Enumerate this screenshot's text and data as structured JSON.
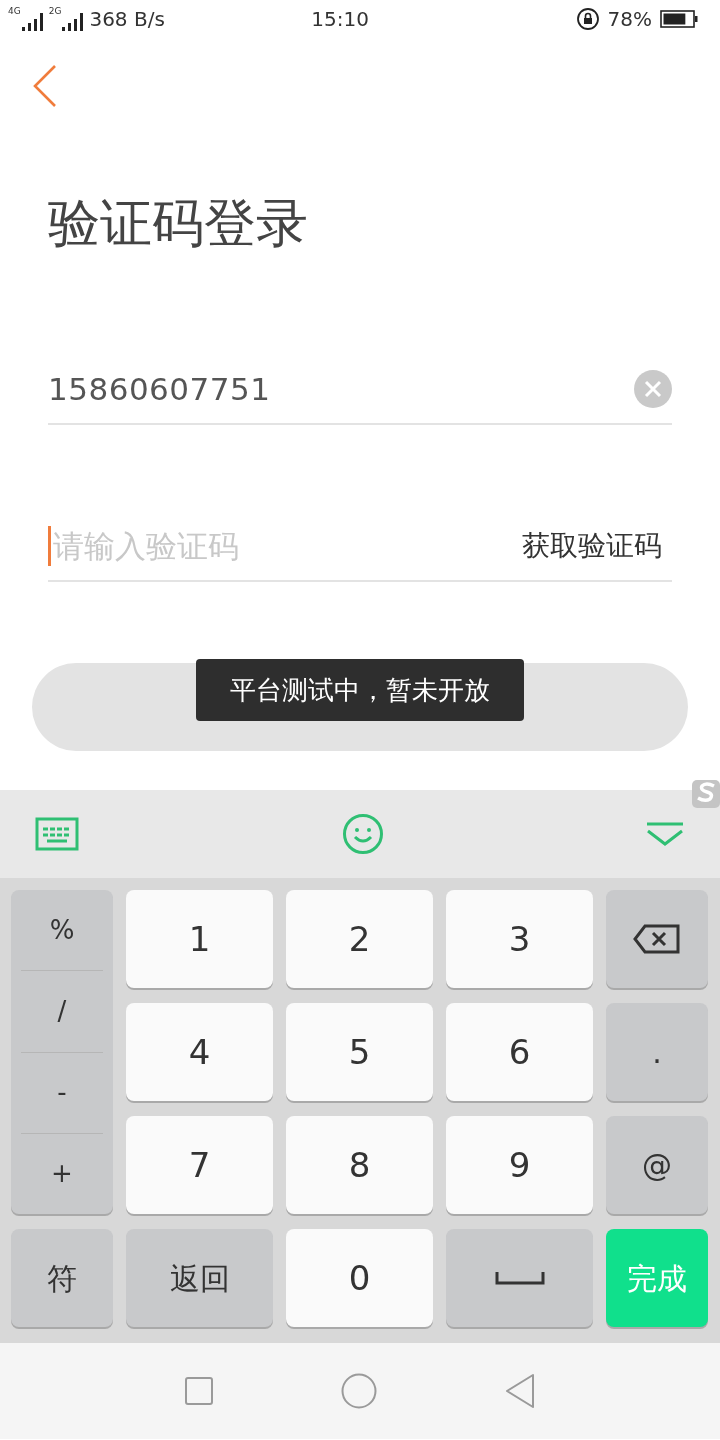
{
  "status_bar": {
    "signal_1_label": "4G",
    "signal_2_label": "2G",
    "network_speed": "368 B/s",
    "time": "15:10",
    "battery": "78%"
  },
  "title": "验证码登录",
  "phone_field": {
    "value": "15860607751"
  },
  "code_field": {
    "placeholder": "请输入验证码",
    "focused": true
  },
  "get_code_button": "获取验证码",
  "toast": "平台测试中，暂未开放",
  "keyboard": {
    "side_keys": [
      "%",
      "/",
      "-",
      "+"
    ],
    "keys": [
      {
        "kind": "light",
        "label": "1"
      },
      {
        "kind": "light",
        "label": "2"
      },
      {
        "kind": "light",
        "label": "3"
      },
      {
        "kind": "backspace"
      },
      {
        "kind": "light",
        "label": "4"
      },
      {
        "kind": "light",
        "label": "5"
      },
      {
        "kind": "light",
        "label": "6"
      },
      {
        "kind": "dark",
        "label": "."
      },
      {
        "kind": "light",
        "label": "7"
      },
      {
        "kind": "light",
        "label": "8"
      },
      {
        "kind": "light",
        "label": "9"
      },
      {
        "kind": "dark",
        "label": "@"
      },
      {
        "kind": "dark",
        "label": "符"
      },
      {
        "kind": "dark",
        "label": "返回"
      },
      {
        "kind": "light",
        "label": "0"
      },
      {
        "kind": "space"
      },
      {
        "kind": "done",
        "label": "完成"
      }
    ]
  }
}
